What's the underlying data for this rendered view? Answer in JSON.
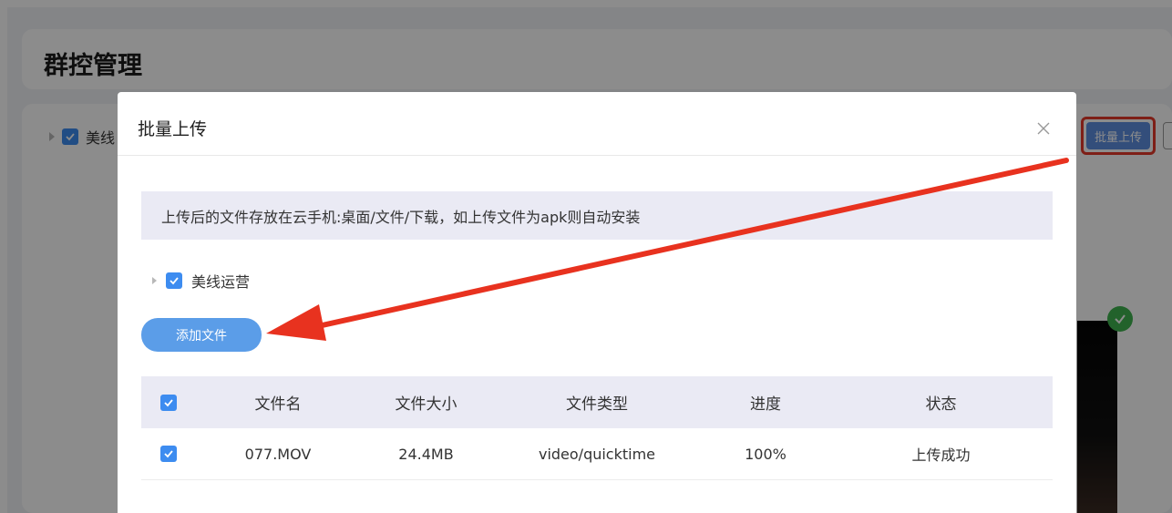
{
  "background": {
    "page_title": "群控管理",
    "tree_label": "美线",
    "upload_button": "批量上传"
  },
  "modal": {
    "title": "批量上传",
    "notice": "上传后的文件存放在云手机:桌面/文件/下载，如上传文件为apk则自动安装",
    "group_label": "美线运营",
    "add_file_button": "添加文件",
    "table": {
      "headers": [
        "文件名",
        "文件大小",
        "文件类型",
        "进度",
        "状态"
      ],
      "rows": [
        [
          "077.MOV",
          "24.4MB",
          "video/quicktime",
          "100%",
          "上传成功"
        ]
      ]
    }
  },
  "colors": {
    "accent": "#3d8cf0",
    "button": "#5b9de8",
    "annotation": "#e53a2a",
    "header_bg": "#eaeaf4"
  },
  "icons": [
    "close-icon",
    "checkbox-checked-icon",
    "caret-right-icon",
    "checkmark-badge-icon"
  ]
}
